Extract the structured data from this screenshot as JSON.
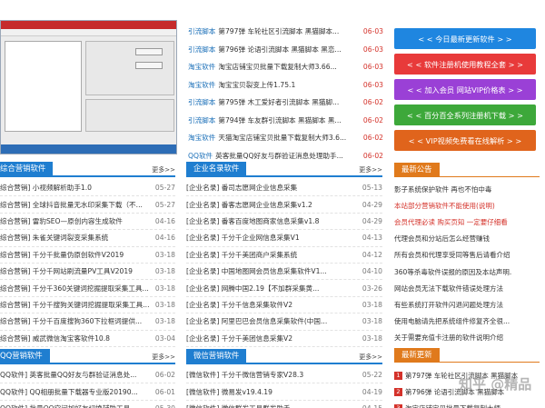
{
  "news": [
    {
      "cat": "引流脚本",
      "text": "第797弹 车轮社区引流脚本 黑猫脚本...",
      "date": "06-03"
    },
    {
      "cat": "引流脚本",
      "text": "第796弹 论语引流脚本 黑猫脚本 黑恋...",
      "date": "06-03"
    },
    {
      "cat": "淘宝软件",
      "text": "淘宝店铺宝贝批量下载复制大师3.66...",
      "date": "06-03"
    },
    {
      "cat": "淘宝软件",
      "text": "淘宝宝贝裂变上传1.75.1",
      "date": "06-03"
    },
    {
      "cat": "引流脚本",
      "text": "第795弹 木工爱好者引流脚本 黑猫脚...",
      "date": "06-02"
    },
    {
      "cat": "引流脚本",
      "text": "第794弹 车友群引流脚本 黑猫脚本 黑...",
      "date": "06-02"
    },
    {
      "cat": "淘宝软件",
      "text": "天猫淘宝店铺宝贝批量下载复制大师3.6...",
      "date": "06-02"
    },
    {
      "cat": "QQ软件",
      "text": "英客批量QQ好友与群验证消息处理助手...",
      "date": "06-02"
    }
  ],
  "buttons": [
    {
      "label": "< < 今日最新更新软件 > >",
      "color": "#1f86e0"
    },
    {
      "label": "< < 软件注册机使用教程全套 > >",
      "color": "#e83a3a"
    },
    {
      "label": "< < 加入会员 网站VIP价格表 > >",
      "color": "#9a40d6"
    },
    {
      "label": "< < 百分百全系列注册机下载 > >",
      "color": "#3da83a"
    },
    {
      "label": "< < VIP视频免费看在线解析 > >",
      "color": "#e0641c"
    }
  ],
  "panels": {
    "integrated": {
      "title": "综合营销软件",
      "more": "更多>>",
      "tab_color": "#1f7ed0",
      "rows": [
        {
          "text": "综合营销] 小视频解析助手1.0",
          "date": "05-27"
        },
        {
          "text": "综合营销] 全球抖音批量无水印采集下载（不...",
          "date": "05-27"
        },
        {
          "text": "综合营销] 雷豹SEO—原创内容生成软件",
          "date": "04-16"
        },
        {
          "text": "综合营销] 朱雀关键词裂变采集系统",
          "date": "04-16"
        },
        {
          "text": "综合营销] 千分千批量伪原创软件V2019",
          "date": "03-18"
        },
        {
          "text": "综合营销] 千分千网站刷流量PV工具V2019",
          "date": "03-18"
        },
        {
          "text": "综合营销] 千分千360关键词挖掘提取采集工具...",
          "date": "03-18"
        },
        {
          "text": "综合营销] 千分千搜狗关键词挖掘提取采集工具...",
          "date": "03-18"
        },
        {
          "text": "综合营销] 千分千百度搜狗360下拉框词提供...",
          "date": "03-18"
        },
        {
          "text": "综合营销] 威武微信淘宝客软件10.8",
          "date": "03-04"
        }
      ]
    },
    "enterprise": {
      "title": "企业名录软件",
      "more": "更多>>",
      "tab_color": "#1f7ed0",
      "rows": [
        {
          "text": "[企业名录] 番司志愿网企业信息采集",
          "date": "05-13"
        },
        {
          "text": "[企业名录] 番客志愿网企业信息采集v1.2",
          "date": "04-29"
        },
        {
          "text": "[企业名录] 番客百度地图商家信息采集v1.8",
          "date": "04-29"
        },
        {
          "text": "[企业名录] 千分千企业网信息采集V1",
          "date": "04-13"
        },
        {
          "text": "[企业名录] 千分千美团商户采集系统",
          "date": "04-12"
        },
        {
          "text": "[企业名录] 中国地图网会员信息采集软件V1...",
          "date": "04-10"
        },
        {
          "text": "[企业名录] 网腾中国2.19【不加群采集黄...",
          "date": "03-26"
        },
        {
          "text": "[企业名录] 千分千信息采集软件V2",
          "date": "03-18"
        },
        {
          "text": "[企业名录] 阿里巴巴会员信息采集软件(中国...",
          "date": "03-18"
        },
        {
          "text": "[企业名录] 千分千美团信息采集V2",
          "date": "03-18"
        }
      ]
    },
    "announce": {
      "title": "最新公告",
      "tab_color": "#e07a1c",
      "rows": [
        {
          "text": "影子系统保护软件 再也不怕中毒",
          "red": false
        },
        {
          "text": "本站部分营销软件不能使用(说明)",
          "red": true
        },
        {
          "text": "会员代理必读 购买页知 一定要仔细看",
          "red": true
        },
        {
          "text": "代理会员和分站后怎么经营赚钱",
          "red": false
        },
        {
          "text": "所有会员和代理享受同等售后请看介绍",
          "red": false
        },
        {
          "text": "360等杀毒软件误报的原因及本站声明.",
          "red": false
        },
        {
          "text": "网站会员无法下载软件错误处理方法",
          "red": false
        },
        {
          "text": "有些系统打开软件闪退问题处理方法",
          "red": false
        },
        {
          "text": "使用电脑请先把系统组件修复齐全很...",
          "red": false
        },
        {
          "text": "关于需要充值卡注册的软件说明介绍",
          "red": false
        }
      ]
    },
    "qq": {
      "title": "QQ营销软件",
      "more": "更多>>",
      "tab_color": "#1f7ed0",
      "rows": [
        {
          "text": "QQ软件] 英客批量QQ好友与群验证消息处...",
          "date": "06-02"
        },
        {
          "text": "QQ软件] QQ相册批量下载器专业版20190...",
          "date": "06-01"
        },
        {
          "text": "QQ软件] 批量QQ空间加好友切换辅助工具...",
          "date": "05-30"
        }
      ]
    },
    "wechat": {
      "title": "微信营销软件",
      "more": "更多>>",
      "tab_color": "#1f7ed0",
      "rows": [
        {
          "text": "[微信软件] 千分千微信营销专家V28.3",
          "date": "05-22"
        },
        {
          "text": "[微信软件] 微易发v19.4.19",
          "date": "04-19"
        },
        {
          "text": "[微信软件] 微信群发工具群发助手...",
          "date": "04-15"
        }
      ]
    },
    "latest": {
      "title": "最新更新",
      "tab_color": "#e07a1c",
      "rows": [
        {
          "rank": "1",
          "text": "第797弹 车轮社区引流脚本 黑猫脚本"
        },
        {
          "rank": "2",
          "text": "第796弹 论语引流脚本 黑猫脚本"
        },
        {
          "rank": "3",
          "text": "淘宝店铺宝贝批量下载复制大师"
        }
      ]
    }
  },
  "watermark": "知乎 @精品"
}
